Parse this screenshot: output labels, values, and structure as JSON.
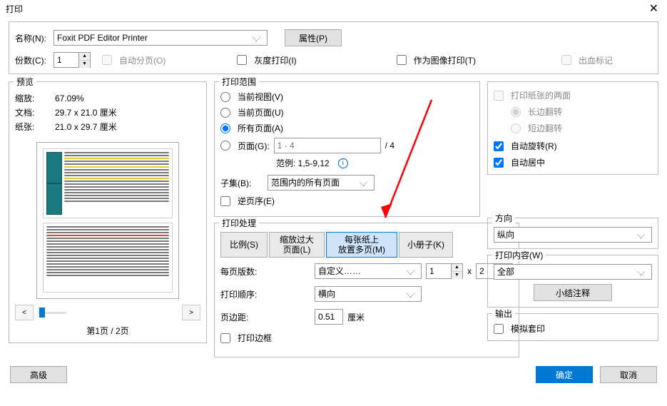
{
  "title": "打印",
  "top": {
    "name_label": "名称(N):",
    "printer": "Foxit PDF Editor Printer",
    "properties_btn": "属性(P)",
    "copies_label": "份数(C):",
    "copies_value": "1",
    "collate_label": "自动分页(O)",
    "grayscale_label": "灰度打印(I)",
    "as_image_label": "作为图像打印(T)",
    "bleed_label": "出血标记"
  },
  "preview": {
    "title": "预览",
    "zoom_label": "缩放:",
    "zoom_value": "67.09%",
    "doc_label": "文档:",
    "doc_value": "29.7 x 21.0 厘米",
    "paper_label": "纸张:",
    "paper_value": "21.0 x 29.7 厘米",
    "nav_prev": "<",
    "nav_next": ">",
    "nav_text": "第1页 / 2页"
  },
  "range": {
    "title": "打印范围",
    "current_view": "当前视图(V)",
    "current_page": "当前页面(U)",
    "all_pages": "所有页面(A)",
    "pages_label": "页面(G):",
    "pages_placeholder": "1 - 4",
    "pages_total": "/ 4",
    "example": "范例: 1,5-9,12",
    "subset_label": "子集(B):",
    "subset_value": "范围内的所有页面",
    "reverse_label": "逆页序(E)"
  },
  "handling": {
    "title": "打印处理",
    "tabs": {
      "scale": "比例(S)",
      "fit": "缩放过大\n页面(L)",
      "multi": "每张纸上\n放置多页(M)",
      "booklet": "小册子(K)"
    },
    "per_sheet_label": "每页版数:",
    "per_sheet_value": "自定义……",
    "per_sheet_cols": "1",
    "per_sheet_x": "x",
    "per_sheet_rows": "2",
    "order_label": "打印顺序:",
    "order_value": "横向",
    "margin_label": "页边距:",
    "margin_value": "0.51",
    "margin_unit": "厘米",
    "border_label": "打印边框"
  },
  "duplex": {
    "both_sides_label": "打印纸张的两面",
    "long_edge": "长边翻转",
    "short_edge": "短边翻转",
    "auto_rotate": "自动旋转(R)",
    "auto_center": "自动居中"
  },
  "orientation": {
    "title": "方向",
    "value": "纵向"
  },
  "content": {
    "title": "打印内容(W)",
    "value": "全部",
    "summarize_btn": "小结注释"
  },
  "output": {
    "title": "输出",
    "simulate_label": "模拟套印"
  },
  "bottom": {
    "advanced": "高级",
    "ok": "确定",
    "cancel": "取消"
  }
}
